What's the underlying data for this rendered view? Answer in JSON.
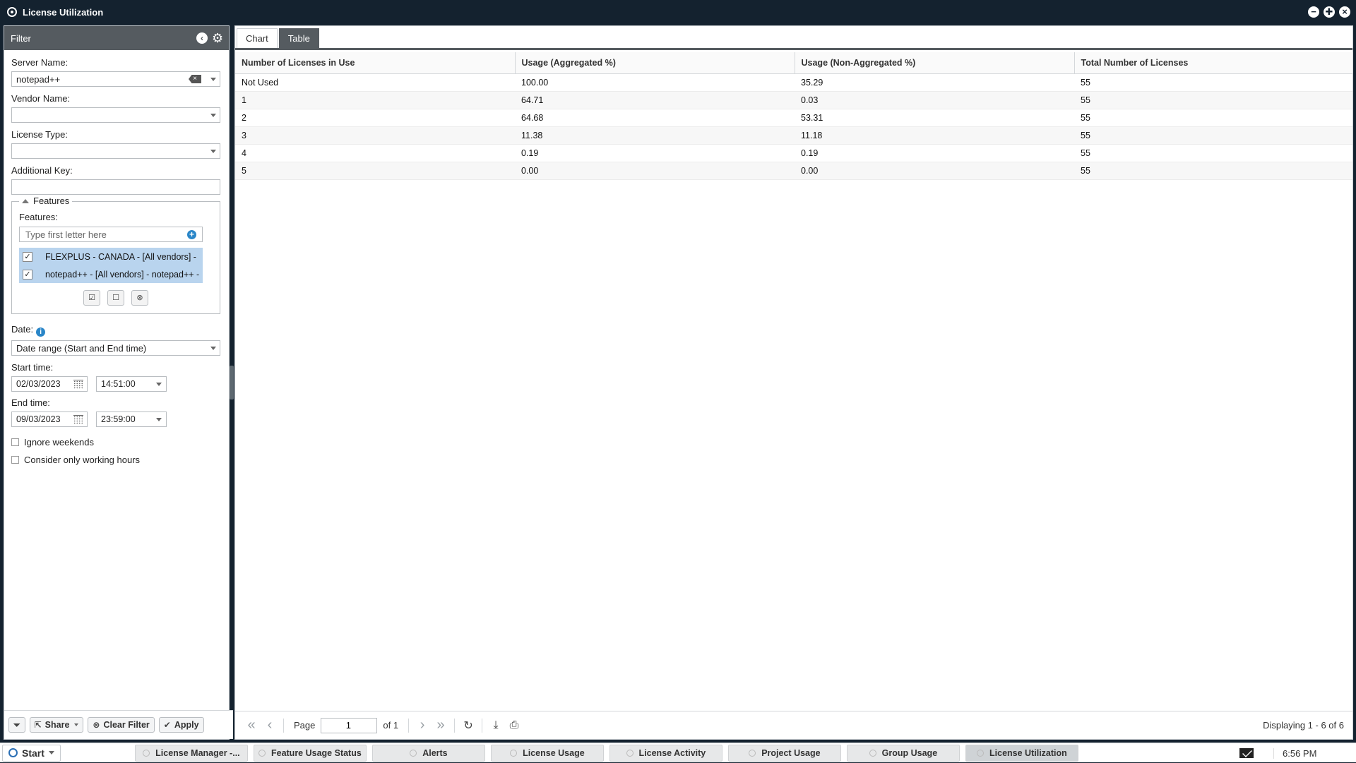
{
  "window": {
    "title": "License Utilization"
  },
  "filter": {
    "title": "Filter",
    "server_name": {
      "label": "Server Name:",
      "value": "notepad++"
    },
    "vendor_name": {
      "label": "Vendor Name:",
      "value": ""
    },
    "license_type": {
      "label": "License Type:",
      "value": ""
    },
    "additional_key": {
      "label": "Additional Key:",
      "value": ""
    },
    "features": {
      "legend": "Features",
      "label": "Features:",
      "search_placeholder": "Type first letter here",
      "items": [
        {
          "label": "FLEXPLUS - CANADA - [All vendors] - ",
          "checked": true
        },
        {
          "label": "notepad++ - [All vendors] - notepad++ - ",
          "checked": true
        }
      ]
    },
    "date": {
      "label": "Date:",
      "value": "Date range (Start and End time)"
    },
    "start_time": {
      "label": "Start time:",
      "date": "02/03/2023",
      "time": "14:51:00"
    },
    "end_time": {
      "label": "End time:",
      "date": "09/03/2023",
      "time": "23:59:00"
    },
    "ignore_weekends": {
      "label": "Ignore weekends",
      "checked": false
    },
    "working_hours": {
      "label": "Consider only working hours",
      "checked": false
    },
    "footer": {
      "share": "Share",
      "clear": "Clear Filter",
      "apply": "Apply"
    }
  },
  "tabs": [
    {
      "label": "Chart",
      "active": false
    },
    {
      "label": "Table",
      "active": true
    }
  ],
  "table": {
    "columns": [
      "Number of Licenses in Use",
      "Usage (Aggregated %)",
      "Usage (Non-Aggregated %)",
      "Total Number of Licenses"
    ],
    "rows": [
      [
        "Not Used",
        "100.00",
        "35.29",
        "55"
      ],
      [
        "1",
        "64.71",
        "0.03",
        "55"
      ],
      [
        "2",
        "64.68",
        "53.31",
        "55"
      ],
      [
        "3",
        "11.38",
        "11.18",
        "55"
      ],
      [
        "4",
        "0.19",
        "0.19",
        "55"
      ],
      [
        "5",
        "0.00",
        "0.00",
        "55"
      ]
    ]
  },
  "pager": {
    "page_label": "Page",
    "page_value": "1",
    "of_label": "of 1",
    "display": "Displaying 1 - 6 of 6"
  },
  "taskbar": {
    "start": "Start",
    "items": [
      {
        "label": "License Manager -...",
        "active": false
      },
      {
        "label": "Feature Usage Status",
        "active": false
      },
      {
        "label": "Alerts",
        "active": false
      },
      {
        "label": "License Usage",
        "active": false
      },
      {
        "label": "License Activity",
        "active": false
      },
      {
        "label": "Project Usage",
        "active": false
      },
      {
        "label": "Group Usage",
        "active": false
      },
      {
        "label": "License Utilization",
        "active": true
      }
    ],
    "clock": "6:56 PM"
  },
  "colors": {
    "titlebar": "#14222f",
    "panel_header": "#555b60",
    "selection": "#b9d4ee",
    "accent": "#2a86c8"
  }
}
